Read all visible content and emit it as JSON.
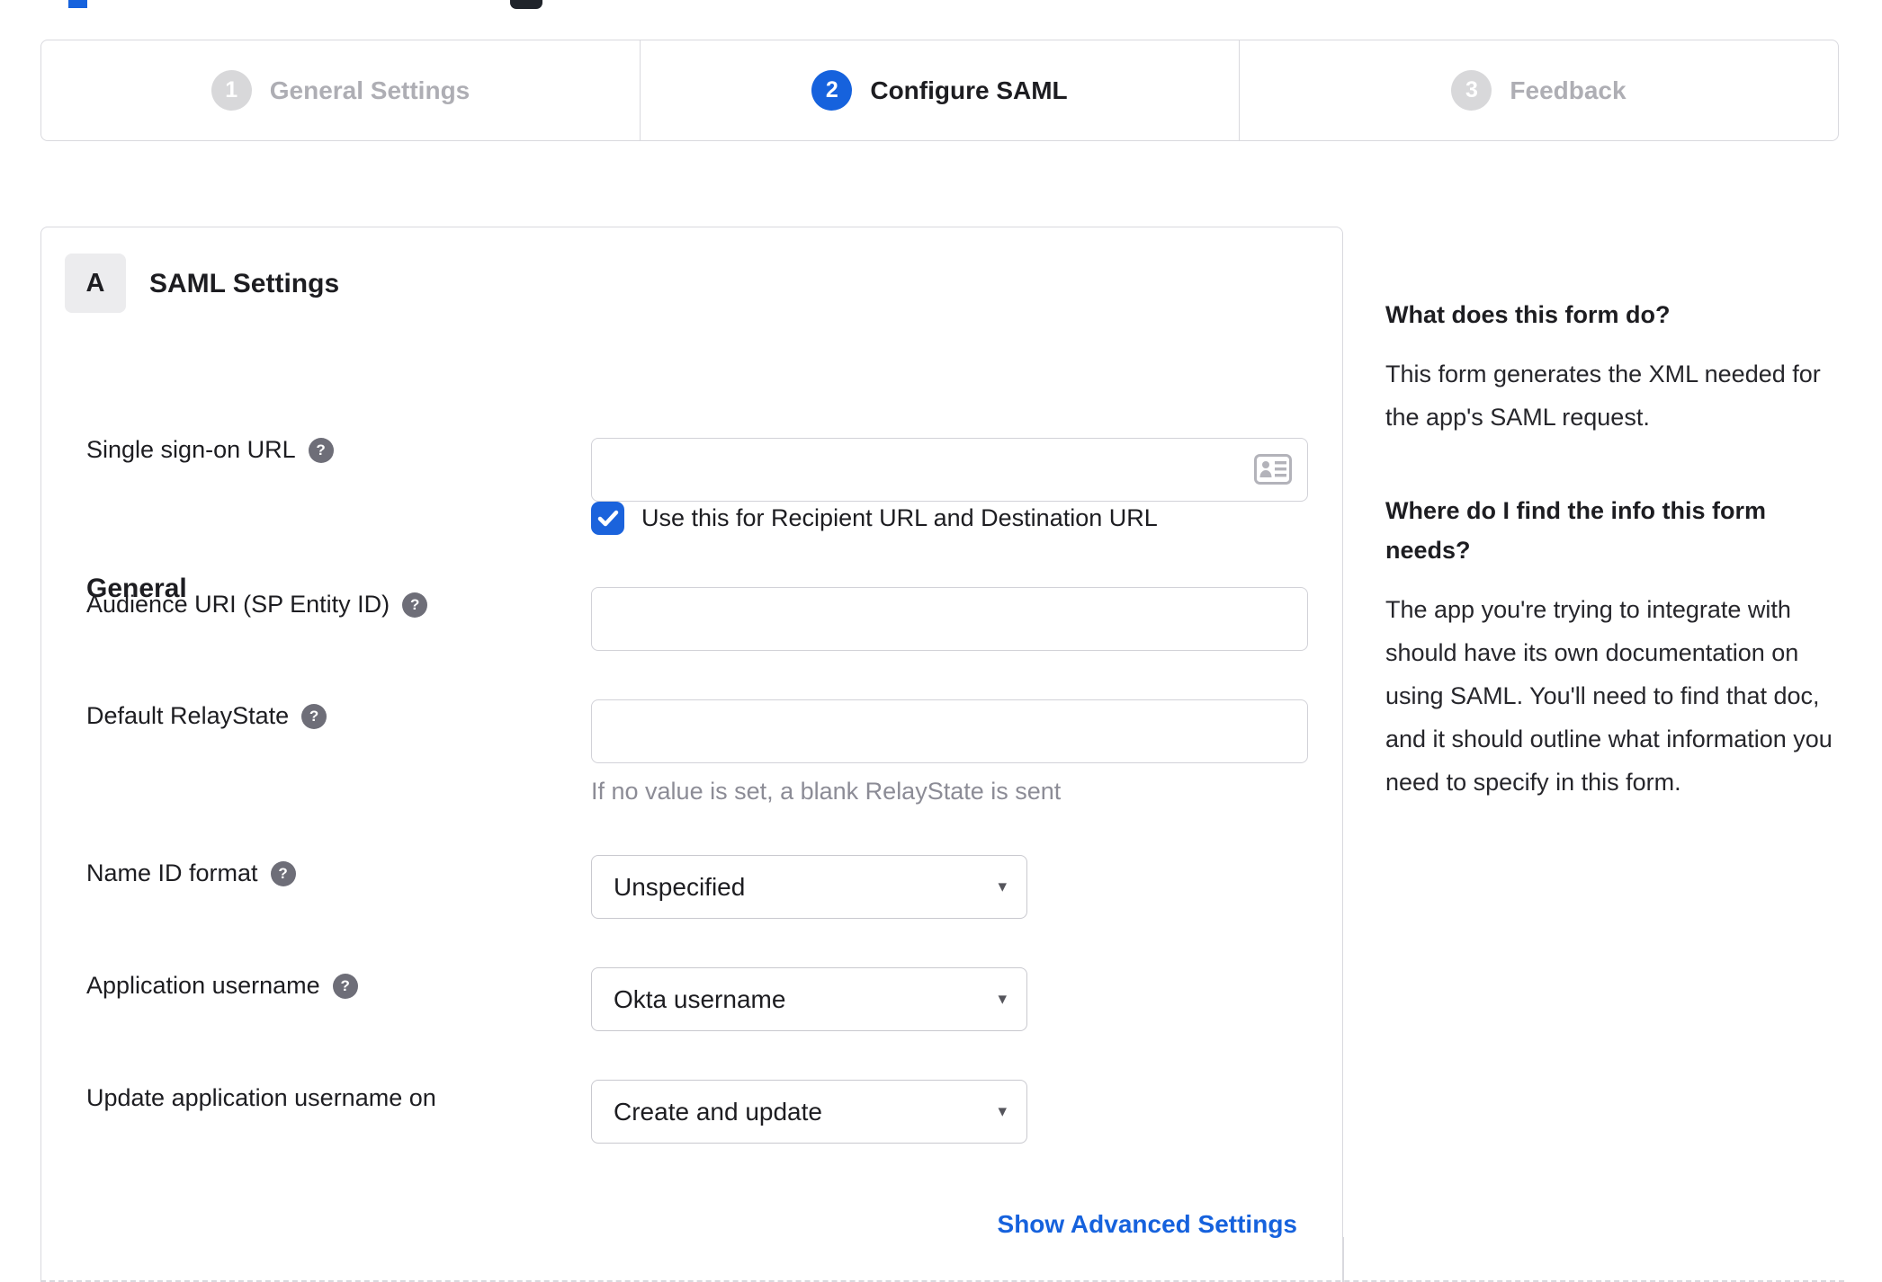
{
  "stepper": {
    "steps": [
      {
        "number": "1",
        "label": "General Settings",
        "state": "inactive"
      },
      {
        "number": "2",
        "label": "Configure SAML",
        "state": "active"
      },
      {
        "number": "3",
        "label": "Feedback",
        "state": "inactive"
      }
    ]
  },
  "panel": {
    "badge": "A",
    "title": "SAML Settings",
    "section_title": "General"
  },
  "form": {
    "rows": [
      {
        "label": "Single sign-on URL",
        "value": "",
        "has_help": true
      },
      {
        "label": "Audience URI (SP Entity ID)",
        "value": "",
        "has_help": true
      },
      {
        "label": "Default RelayState",
        "value": "",
        "has_help": true,
        "hint": "If no value is set, a blank RelayState is sent"
      },
      {
        "label": "Name ID format",
        "value": "Unspecified",
        "has_help": true
      },
      {
        "label": "Application username",
        "value": "Okta username",
        "has_help": true
      },
      {
        "label": "Update application username on",
        "value": "Create and update",
        "has_help": false
      }
    ],
    "checkbox_label": "Use this for Recipient URL and Destination URL",
    "checkbox_checked": true,
    "advanced_link": "Show Advanced Settings"
  },
  "help": {
    "q1_title": "What does this form do?",
    "q1_body": "This form generates the XML needed for the app's SAML request.",
    "q2_title": "Where do I find the info this form needs?",
    "q2_body": "The app you're trying to integrate with should have its own documentation on using SAML. You'll need to find that doc, and it should outline what information you need to specify in this form."
  },
  "icons": {
    "help_glyph": "?",
    "dropdown_arrow": "▾"
  },
  "colors": {
    "accent_blue": "#1662dd",
    "checkbox_blue": "#1b63dc",
    "inactive_gray": "#aeaeb4",
    "text_dark": "#1d1d21",
    "hint_gray": "#8c8c96",
    "border_gray": "#d9d9de"
  }
}
